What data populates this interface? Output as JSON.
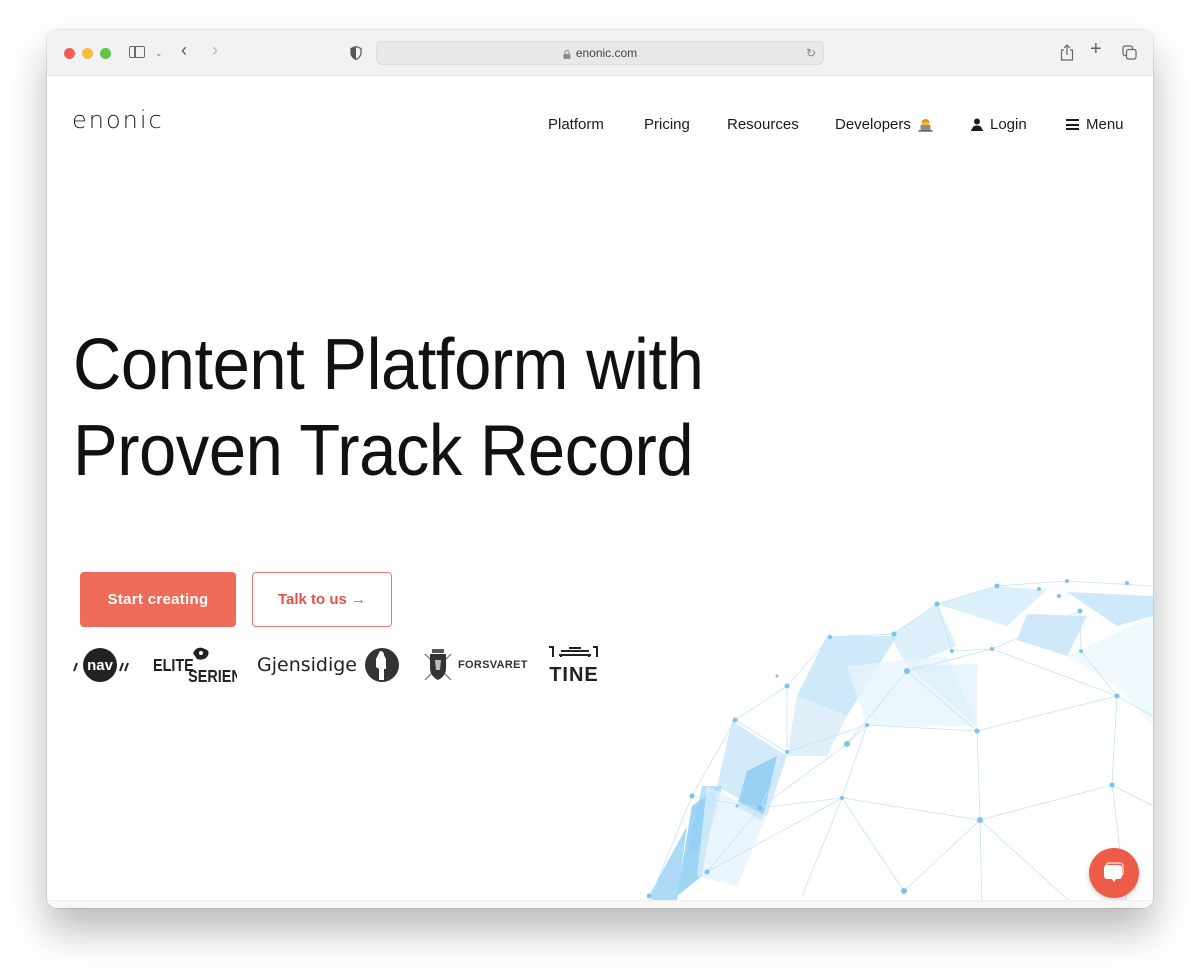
{
  "browser": {
    "url": "enonic.com",
    "icons": [
      "sidebar-icon",
      "chevron-down-icon",
      "back-icon",
      "forward-icon",
      "shield-icon",
      "lock-icon",
      "reload-icon",
      "share-icon",
      "new-tab-icon",
      "tabs-overview-icon"
    ],
    "glyphs": {
      "chevron_down": "⌄",
      "back": "‹",
      "forward": "›",
      "reload": "↻",
      "plus": "+"
    }
  },
  "site": {
    "logo": "enonic",
    "nav": {
      "platform": "Platform",
      "pricing": "Pricing",
      "resources": "Resources",
      "developers": "Developers",
      "login": "Login",
      "menu": "Menu"
    },
    "hero": {
      "title_line1": "Content Platform with",
      "title_line2": "Proven Track Record"
    },
    "cta": {
      "primary": "Start creating",
      "secondary": "Talk to us →"
    },
    "clients": {
      "nav": "nav",
      "elite_top": "ELITE",
      "elite_bottom": "SERIEN",
      "gjensidige": "Gjensidige",
      "forsvaret": "FORSVARET",
      "tine": "TINE"
    },
    "colors": {
      "accent": "#ee6b5a",
      "accent_text": "#d9574a",
      "globe": "#8fcdf3",
      "chat": "#ec5c48"
    }
  }
}
